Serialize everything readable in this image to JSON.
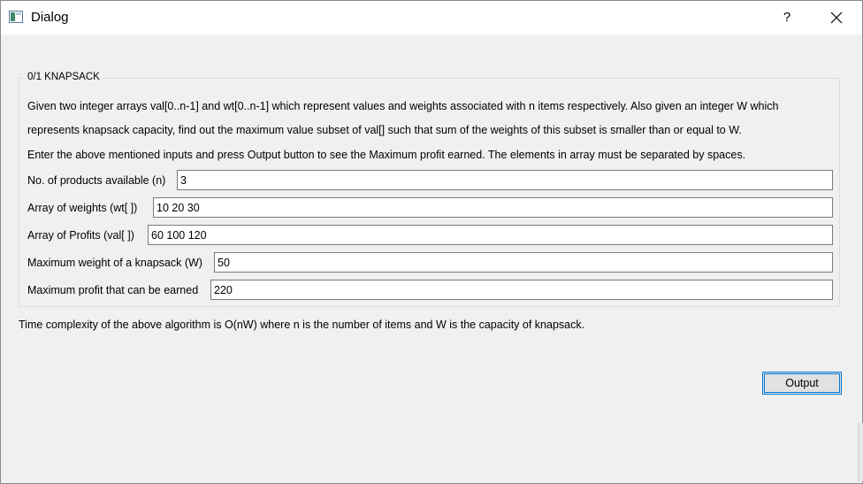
{
  "window": {
    "title": "Dialog",
    "help_label": "?"
  },
  "group": {
    "title": "0/1 KNAPSACK",
    "description": [
      "Given two integer arrays val[0..n-1] and wt[0..n-1] which represent values and weights associated with n items respectively. Also given an integer W which",
      "represents knapsack capacity, find out the maximum value subset of val[] such that sum of the weights of this subset is smaller than or equal to W.",
      "Enter the above mentioned inputs and press Output button to see the Maximum profit earned.  The elements in array must be separated by spaces."
    ],
    "fields": [
      {
        "label": "No. of products available (n)",
        "value": "3"
      },
      {
        "label": "Array of weights (wt[ ])",
        "value": "10 20 30"
      },
      {
        "label": "Array of Profits (val[ ])",
        "value": "60 100 120"
      },
      {
        "label": "Maximum weight of a knapsack (W)",
        "value": "50"
      },
      {
        "label": "Maximum profit that can be earned",
        "value": "220"
      }
    ]
  },
  "complexity_note": "Time complexity of the above algorithm is O(nW) where n is the number of items and W is the capacity of knapsack.",
  "buttons": {
    "output_label": "Output"
  },
  "icons": {
    "app": "dialog-app-icon",
    "close": "close-icon"
  },
  "colors": {
    "focus_border": "#0078d7",
    "window_bg": "#f0f0f0"
  }
}
